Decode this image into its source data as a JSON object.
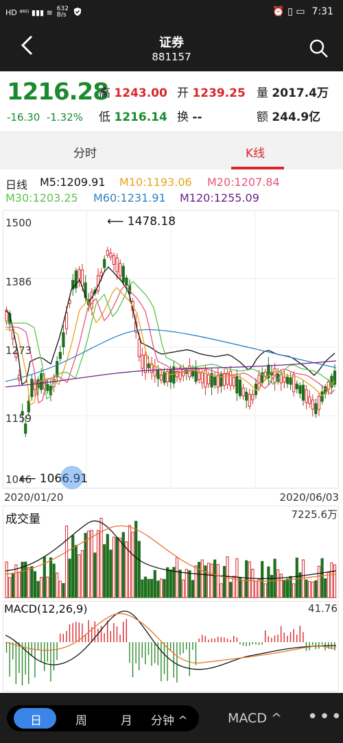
{
  "status_bar": {
    "left": "HD ⁴⁶ᴳ ▮▮▮ ≋",
    "speed_value": "632",
    "speed_unit": "B/s",
    "time": "7:31",
    "right_icons": "⏰ ▯ ▭"
  },
  "header": {
    "title": "证券",
    "code": "881157"
  },
  "quote": {
    "price": "1216.28",
    "change": "-16.30",
    "change_pct": "-1.32%",
    "high_label": "高",
    "high": "1243.00",
    "low_label": "低",
    "low": "1216.14",
    "open_label": "开",
    "open": "1239.25",
    "turnover_label": "换",
    "turnover": "--",
    "volume_label": "量",
    "volume": "2017.4万",
    "amount_label": "额",
    "amount": "244.9亿"
  },
  "tabs": [
    {
      "label": "分时",
      "active": false
    },
    {
      "label": "K线",
      "active": true
    }
  ],
  "ma_legend": {
    "period": "日线",
    "m5": "M5:1209.91",
    "m10": "M10:1193.06",
    "m20": "M20:1207.84",
    "m30": "M30:1203.25",
    "m60": "M60:1231.91",
    "m120": "M120:1255.09"
  },
  "kline": {
    "y_labels": [
      "1500",
      "1386",
      "1273",
      "1159",
      "1046"
    ],
    "max_marker": "1478.18",
    "min_marker": "1066.91",
    "start_date": "2020/01/20",
    "end_date": "2020/06/03"
  },
  "volume_panel": {
    "label": "成交量",
    "max": "7225.6万"
  },
  "macd_panel": {
    "label": "MACD(12,26,9)",
    "max": "41.76"
  },
  "colors": {
    "up": "#d8262b",
    "down": "#1e6e1e",
    "ma5": "#111111",
    "ma10": "#e8a31c",
    "ma20": "#e8557a",
    "ma30": "#5cc24a",
    "ma60": "#2f7fc1",
    "ma120": "#6b1f8a",
    "accent": "#3a86e8"
  },
  "bottom_bar": {
    "periods": [
      "日",
      "周",
      "月",
      "分钟 ^"
    ],
    "indicator": "MACD ^",
    "more": "•••"
  }
}
